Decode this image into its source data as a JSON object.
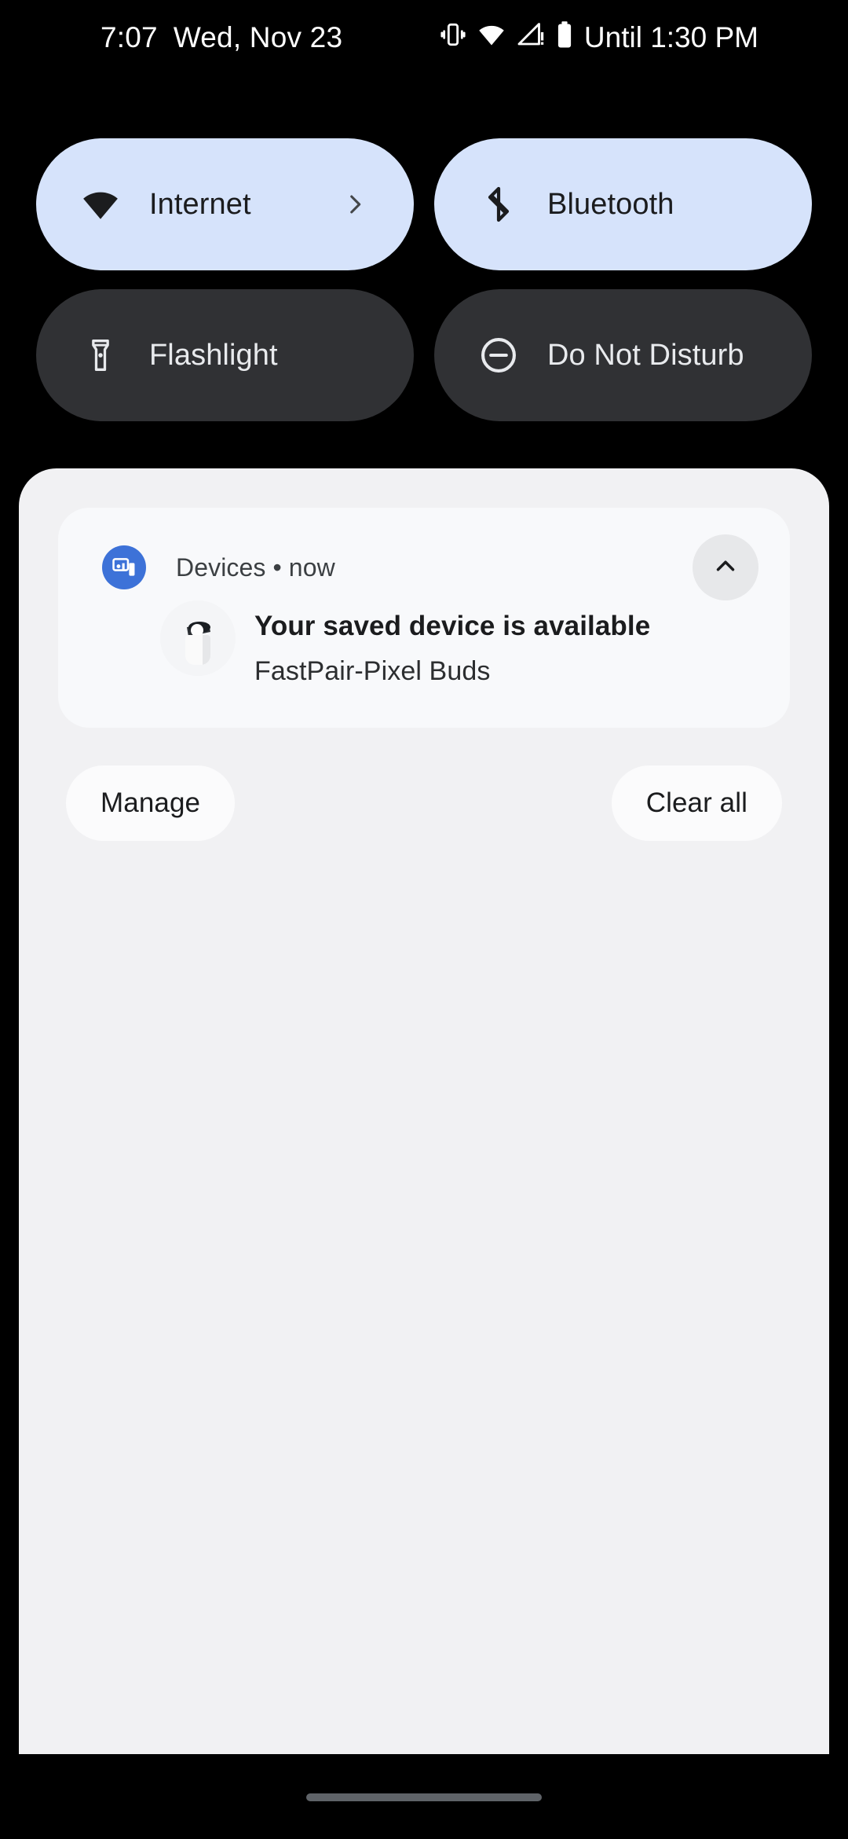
{
  "status_bar": {
    "time": "7:07",
    "date": "Wed, Nov 23",
    "dnd_until": "Until 1:30 PM",
    "icons": [
      "vibrate-icon",
      "wifi-icon",
      "cellular-signal-warning-icon",
      "battery-icon"
    ]
  },
  "quick_settings": {
    "tiles": [
      {
        "label": "Internet",
        "icon": "wifi-icon",
        "state": "active",
        "has_chevron": true
      },
      {
        "label": "Bluetooth",
        "icon": "bluetooth-icon",
        "state": "active",
        "has_chevron": false
      },
      {
        "label": "Flashlight",
        "icon": "flashlight-icon",
        "state": "inactive",
        "has_chevron": false
      },
      {
        "label": "Do Not Disturb",
        "icon": "dnd-minus-circle-icon",
        "state": "inactive",
        "has_chevron": false
      }
    ]
  },
  "notification": {
    "app_name": "Devices",
    "separator": "•",
    "timestamp": "now",
    "header_text": "Devices • now",
    "title": "Your saved device is available",
    "subtitle": "FastPair-Pixel Buds",
    "app_icon": "devices-icon",
    "device_thumb": "pixel-buds-case-image",
    "expand_icon": "chevron-up-icon"
  },
  "shade_actions": {
    "manage": "Manage",
    "clear_all": "Clear all"
  },
  "colors": {
    "tile_active_bg": "#d6e3fb",
    "tile_inactive_bg": "#303134",
    "shade_bg": "#f1f1f3",
    "notif_card_bg": "#f8f9fb",
    "app_icon_blue": "#3d72d8",
    "text_primary": "#1b1c1e",
    "background": "#000000"
  }
}
